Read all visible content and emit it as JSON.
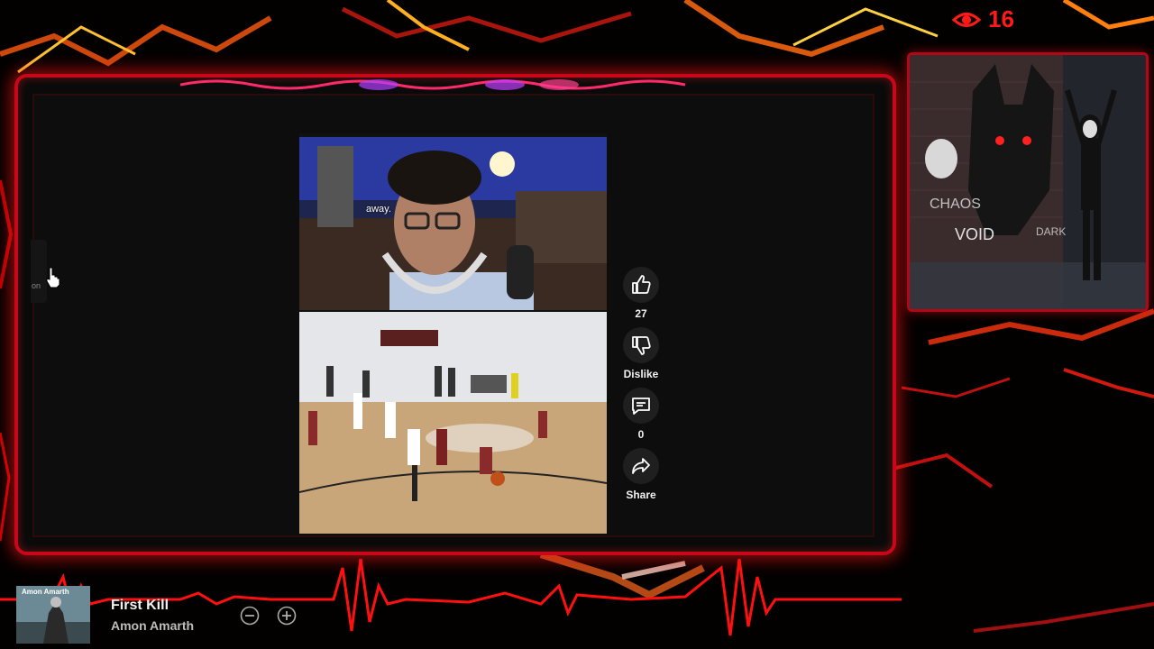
{
  "stream": {
    "viewer_count": "16",
    "eye_icon": "eye-icon"
  },
  "video": {
    "caption": "away."
  },
  "actions": {
    "like_count": "27",
    "dislike_label": "Dislike",
    "comment_count": "0",
    "share_label": "Share"
  },
  "sidebar_handle": {
    "label": "on"
  },
  "now_playing": {
    "title": "First Kill",
    "artist": "Amon Amarth",
    "album_text": "Amon Amarth"
  },
  "overlay_art": {
    "text_1": "CHAOS",
    "text_2": "VOID",
    "text_3": "DARK"
  },
  "colors": {
    "accent": "#e0081c",
    "panel": "#0d0d0d"
  }
}
